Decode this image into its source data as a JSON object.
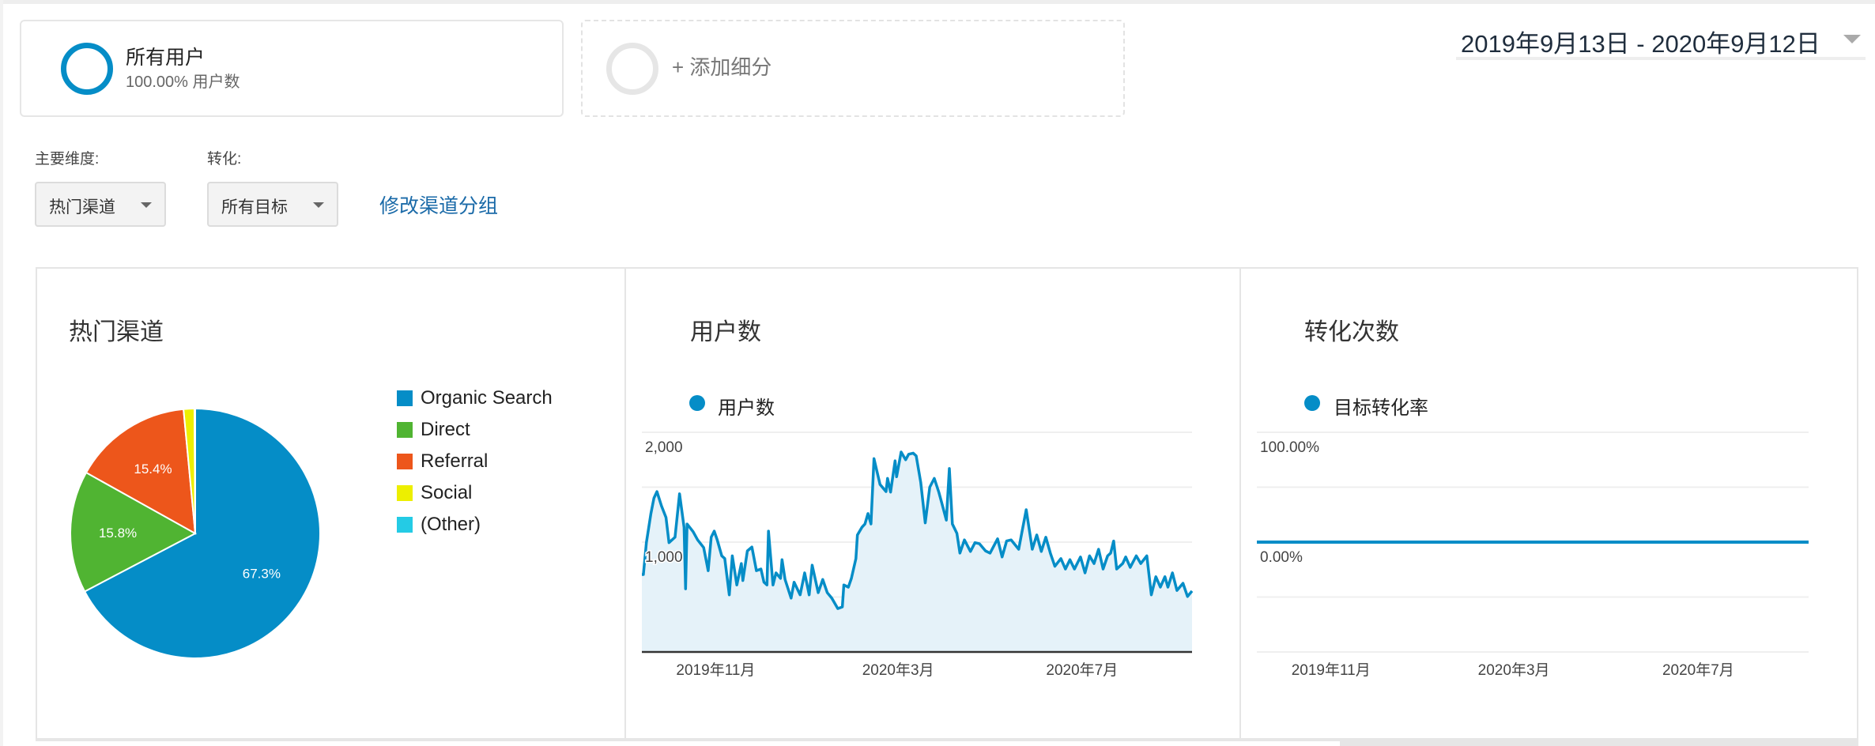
{
  "segments": {
    "active": {
      "title": "所有用户",
      "subtitle": "100.00% 用户数",
      "color": "#058dc7"
    },
    "add_label": "+ 添加细分"
  },
  "date_range": {
    "label": "2019年9月13日 - 2020年9月12日"
  },
  "controls": {
    "primary_dimension_label": "主要维度:",
    "primary_dimension_value": "热门渠道",
    "conversion_label": "转化:",
    "conversion_value": "所有目标",
    "edit_link": "修改渠道分组"
  },
  "panels": {
    "channels": {
      "title": "热门渠道"
    },
    "users": {
      "title": "用户数",
      "legend": "用户数",
      "color": "#058dc7"
    },
    "conversions": {
      "title": "转化次数",
      "legend": "目标转化率",
      "color": "#058dc7"
    }
  },
  "chart_data": [
    {
      "type": "pie",
      "title": "热门渠道",
      "legend_position": "right",
      "categories": [
        "Organic Search",
        "Direct",
        "Referral",
        "Social",
        "(Other)"
      ],
      "values": [
        67.3,
        15.8,
        15.4,
        1.4,
        0.1
      ],
      "labels": [
        "67.3%",
        "15.8%",
        "15.4%",
        "",
        ""
      ],
      "colors": [
        "#058dc7",
        "#50b432",
        "#ed561b",
        "#edef00",
        "#24cbe5"
      ]
    },
    {
      "type": "area",
      "title": "用户数",
      "series_name": "用户数",
      "x_domain_days": [
        0,
        365
      ],
      "start_date": "2019-09-13",
      "end_date": "2020-09-12",
      "ylim": [
        0,
        2000
      ],
      "yticks": [
        {
          "value": 2000,
          "label": "2,000"
        },
        {
          "value": 1000,
          "label": "1,000"
        }
      ],
      "grid_values": [
        2000,
        1500,
        1000,
        500
      ],
      "xticks": [
        {
          "day": 49,
          "label": "2019年11月"
        },
        {
          "day": 170,
          "label": "2020年3月"
        },
        {
          "day": 292,
          "label": "2020年7月"
        }
      ],
      "points": [
        [
          0,
          705
        ],
        [
          1,
          705
        ],
        [
          3,
          995
        ],
        [
          6,
          1260
        ],
        [
          8,
          1400
        ],
        [
          10,
          1460
        ],
        [
          13,
          1330
        ],
        [
          16,
          1225
        ],
        [
          18,
          995
        ],
        [
          22,
          1045
        ],
        [
          25,
          1440
        ],
        [
          28,
          1135
        ],
        [
          29,
          575
        ],
        [
          30,
          1165
        ],
        [
          34,
          1095
        ],
        [
          37,
          1020
        ],
        [
          41,
          950
        ],
        [
          44,
          740
        ],
        [
          46,
          1045
        ],
        [
          48,
          1100
        ],
        [
          50,
          1020
        ],
        [
          53,
          875
        ],
        [
          55,
          850
        ],
        [
          58,
          520
        ],
        [
          60,
          875
        ],
        [
          63,
          610
        ],
        [
          66,
          805
        ],
        [
          67,
          650
        ],
        [
          70,
          920
        ],
        [
          73,
          955
        ],
        [
          76,
          740
        ],
        [
          79,
          755
        ],
        [
          81,
          635
        ],
        [
          83,
          610
        ],
        [
          84,
          1100
        ],
        [
          87,
          610
        ],
        [
          89,
          720
        ],
        [
          92,
          670
        ],
        [
          93,
          840
        ],
        [
          95,
          660
        ],
        [
          99,
          490
        ],
        [
          101,
          635
        ],
        [
          105,
          520
        ],
        [
          108,
          720
        ],
        [
          111,
          520
        ],
        [
          113,
          790
        ],
        [
          117,
          540
        ],
        [
          120,
          660
        ],
        [
          123,
          540
        ],
        [
          126,
          490
        ],
        [
          130,
          395
        ],
        [
          133,
          410
        ],
        [
          134,
          610
        ],
        [
          137,
          590
        ],
        [
          139,
          670
        ],
        [
          142,
          850
        ],
        [
          143,
          1065
        ],
        [
          146,
          1135
        ],
        [
          148,
          1165
        ],
        [
          150,
          1260
        ],
        [
          152,
          1165
        ],
        [
          154,
          1760
        ],
        [
          158,
          1525
        ],
        [
          162,
          1460
        ],
        [
          163,
          1580
        ],
        [
          165,
          1455
        ],
        [
          168,
          1740
        ],
        [
          169,
          1595
        ],
        [
          172,
          1820
        ],
        [
          175,
          1750
        ],
        [
          177,
          1800
        ],
        [
          180,
          1810
        ],
        [
          182,
          1785
        ],
        [
          185,
          1545
        ],
        [
          188,
          1175
        ],
        [
          191,
          1500
        ],
        [
          194,
          1580
        ],
        [
          197,
          1455
        ],
        [
          199,
          1355
        ],
        [
          202,
          1200
        ],
        [
          204,
          1670
        ],
        [
          206,
          1165
        ],
        [
          209,
          1080
        ],
        [
          211,
          900
        ],
        [
          214,
          1020
        ],
        [
          218,
          915
        ],
        [
          221,
          995
        ],
        [
          224,
          985
        ],
        [
          228,
          920
        ],
        [
          231,
          900
        ],
        [
          236,
          1030
        ],
        [
          239,
          865
        ],
        [
          242,
          1010
        ],
        [
          245,
          1020
        ],
        [
          250,
          935
        ],
        [
          252,
          1080
        ],
        [
          255,
          1295
        ],
        [
          259,
          935
        ],
        [
          262,
          1065
        ],
        [
          265,
          915
        ],
        [
          268,
          1045
        ],
        [
          271,
          900
        ],
        [
          274,
          780
        ],
        [
          278,
          850
        ],
        [
          281,
          755
        ],
        [
          284,
          840
        ],
        [
          287,
          755
        ],
        [
          291,
          865
        ],
        [
          294,
          720
        ],
        [
          297,
          875
        ],
        [
          300,
          805
        ],
        [
          303,
          935
        ],
        [
          306,
          755
        ],
        [
          309,
          875
        ],
        [
          311,
          900
        ],
        [
          313,
          1010
        ],
        [
          315,
          755
        ],
        [
          319,
          805
        ],
        [
          321,
          865
        ],
        [
          324,
          770
        ],
        [
          328,
          875
        ],
        [
          331,
          805
        ],
        [
          335,
          875
        ],
        [
          338,
          520
        ],
        [
          341,
          685
        ],
        [
          344,
          590
        ],
        [
          347,
          685
        ],
        [
          349,
          590
        ],
        [
          352,
          720
        ],
        [
          355,
          560
        ],
        [
          359,
          625
        ],
        [
          362,
          505
        ],
        [
          365,
          555
        ]
      ]
    },
    {
      "type": "line",
      "title": "转化次数",
      "series_name": "目标转化率",
      "x_domain_days": [
        0,
        365
      ],
      "ylim": [
        -100,
        100
      ],
      "yticks": [
        {
          "value": 100,
          "label": "100.00%"
        },
        {
          "value": 0,
          "label": "0.00%"
        }
      ],
      "grid_values": [
        100,
        50,
        0,
        -50,
        -100
      ],
      "xticks": [
        {
          "day": 49,
          "label": "2019年11月"
        },
        {
          "day": 170,
          "label": "2020年3月"
        },
        {
          "day": 292,
          "label": "2020年7月"
        }
      ],
      "points": [
        [
          0,
          0
        ],
        [
          365,
          0
        ]
      ]
    }
  ]
}
